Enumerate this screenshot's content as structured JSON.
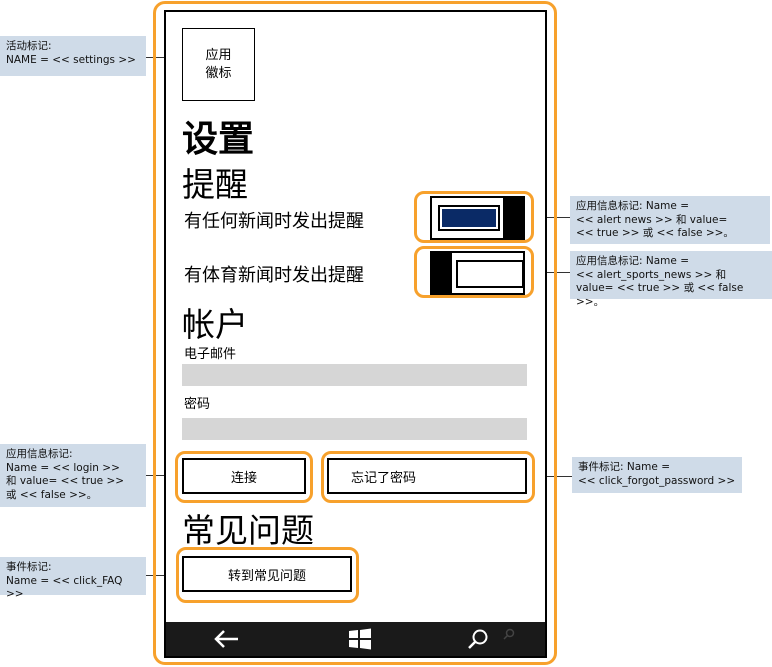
{
  "app_icon": {
    "text": "应用\n徽标"
  },
  "page_title": "设置",
  "sections": {
    "alerts": {
      "heading": "提醒",
      "items": [
        {
          "label": "有任何新闻时发出提醒",
          "value": true
        },
        {
          "label": "有体育新闻时发出提醒",
          "value": false
        }
      ]
    },
    "account": {
      "heading": "帐户",
      "email_label": "电子邮件",
      "email_value": "",
      "password_label": "密码",
      "password_value": "",
      "connect_button": "连接",
      "forgot_button": "忘记了密码"
    },
    "faq": {
      "heading": "常见问题",
      "goto_button": "转到常见问题"
    }
  },
  "annotations": {
    "activity": "活动标记:\nNAME = << settings >>",
    "alert_news": "应用信息标记: Name =\n<< alert news >> 和 value=\n<< true >> 或 << false >>。",
    "alert_sports": "应用信息标记: Name =\n<< alert_sports_news >> 和\nvalue= << true >> 或 << false >>。",
    "login": "应用信息标记:\nName = << login >>\n和 value= << true >>\n或 << false >>。",
    "forgot": "事件标记: Name =\n<< click_forgot_password >>",
    "faq": "事件标记:\nName = << click_FAQ >>"
  },
  "colors": {
    "highlight": "#f7a12c",
    "callout_bg": "#cfdbe8",
    "toggle_on_fill": "#0a2a66",
    "field_bg": "#d6d6d6",
    "appbar_bg": "#1a1a1a"
  },
  "app_bar_icons": [
    "back-arrow-icon",
    "windows-start-icon",
    "search-icon"
  ]
}
